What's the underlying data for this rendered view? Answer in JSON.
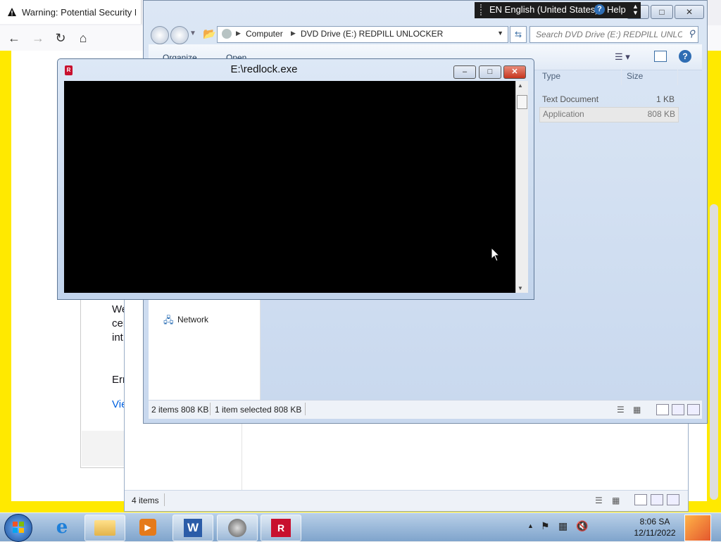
{
  "firefox": {
    "tab_title": "Warning: Potential Security Risk Ahead",
    "body_lines": [
      "We",
      "cer",
      "int"
    ],
    "error_text": "Err",
    "view_link": "Vie"
  },
  "explorer": {
    "address": {
      "segments": [
        "Computer",
        "DVD Drive (E:) REDPILL UNLOCKER"
      ]
    },
    "search_placeholder": "Search DVD Drive (E:) REDPILL UNLO...",
    "toolbar": {
      "organize": "Organize",
      "open": "Open"
    },
    "columns": {
      "type": "Type",
      "size": "Size"
    },
    "files": [
      {
        "type": "Text Document",
        "size": "1 KB"
      },
      {
        "type": "Application",
        "size": "808 KB"
      }
    ],
    "nav_network": "Network",
    "status": {
      "items": "2 items  808 KB",
      "selected": "1 item selected  808 KB"
    }
  },
  "explorer_back": {
    "status_items": "4 items"
  },
  "language_bar": {
    "lang": "EN English (United States)",
    "help": "Help"
  },
  "console": {
    "title": "E:\\redlock.exe"
  },
  "taskbar": {
    "time": "8:06 SA",
    "date": "12/11/2022"
  }
}
